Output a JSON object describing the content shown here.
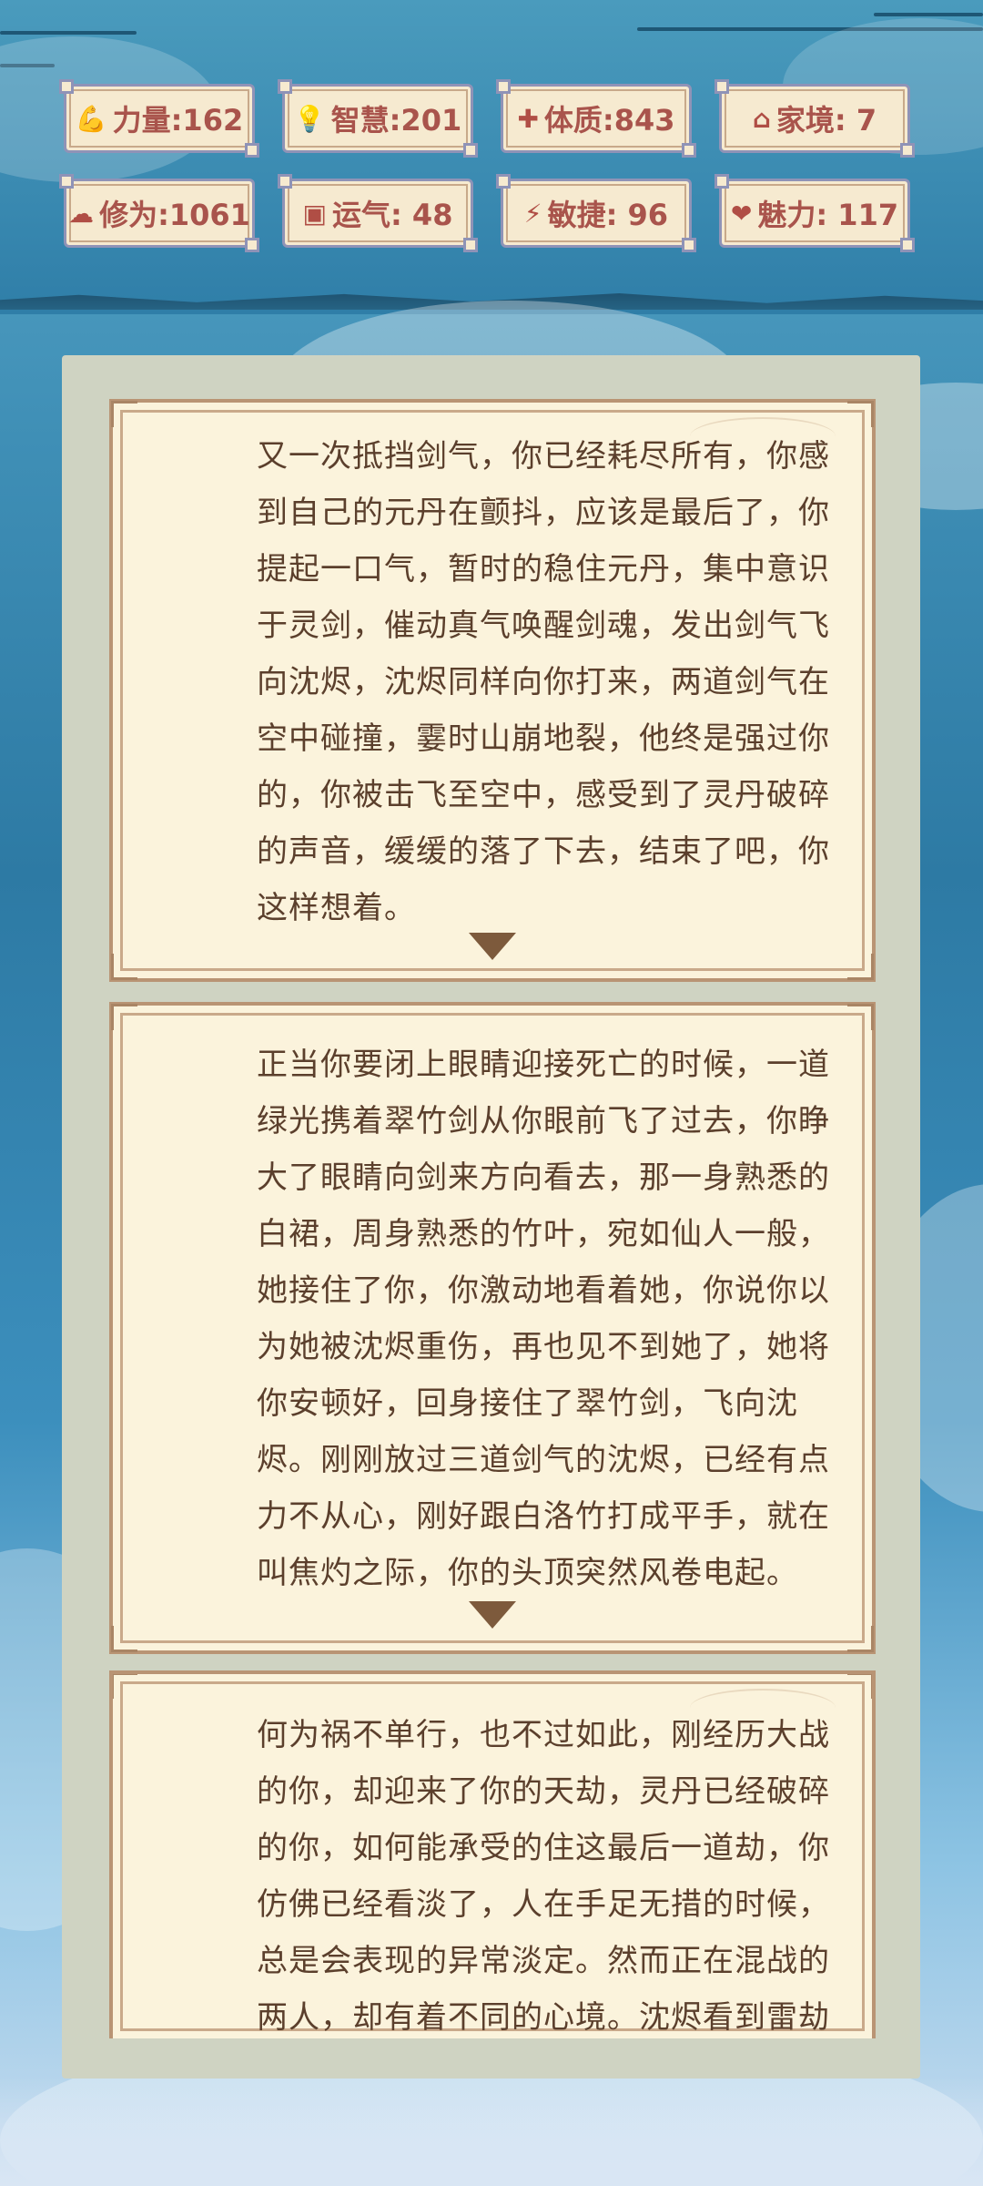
{
  "stats": [
    {
      "icon": "muscle-icon",
      "glyph": "💪",
      "label": "力量:162"
    },
    {
      "icon": "lightbulb-icon",
      "glyph": "💡",
      "label": "智慧:201"
    },
    {
      "icon": "health-icon",
      "glyph": "✚",
      "label": "体质:843"
    },
    {
      "icon": "home-icon",
      "glyph": "⌂",
      "label": "家境:  7"
    },
    {
      "icon": "cloud-icon",
      "glyph": "☁",
      "label": "修为:1061"
    },
    {
      "icon": "luck-icon",
      "glyph": "▣",
      "label": "运气: 48"
    },
    {
      "icon": "lightning-icon",
      "glyph": "⚡",
      "label": "敏捷: 96"
    },
    {
      "icon": "heart-icon",
      "glyph": "❤",
      "label": "魅力: 117"
    }
  ],
  "story": {
    "paragraph_1": "又一次抵挡剑气，你已经耗尽所有，你感到自己的元丹在颤抖，应该是最后了，你提起一口气，暂时的稳住元丹，集中意识于灵剑，催动真气唤醒剑魂，发出剑气飞向沈烬，沈烬同样向你打来，两道剑气在空中碰撞，霎时山崩地裂，他终是强过你的，你被击飞至空中，感受到了灵丹破碎的声音，缓缓的落了下去，结束了吧，你这样想着。",
    "paragraph_2": "正当你要闭上眼睛迎接死亡的时候，一道绿光携着翠竹剑从你眼前飞了过去，你睁大了眼睛向剑来方向看去，那一身熟悉的白裙，周身熟悉的竹叶，宛如仙人一般，她接住了你，你激动地看着她，你说你以为她被沈烬重伤，再也见不到她了，她将你安顿好，回身接住了翠竹剑，飞向沈烬。刚刚放过三道剑气的沈烬，已经有点力不从心，刚好跟白洛竹打成平手，就在叫焦灼之际，你的头顶突然风卷电起。",
    "paragraph_3": "何为祸不单行，也不过如此，刚经历大战的你，却迎来了你的天劫，灵丹已经破碎的你，如何能承受的住这最后一道劫，你仿佛已经看淡了，人在手足无措的时候，总是会表现的异常淡定。然而正在混战的两人，却有着不同的心境。沈烬看到雷劫"
  }
}
